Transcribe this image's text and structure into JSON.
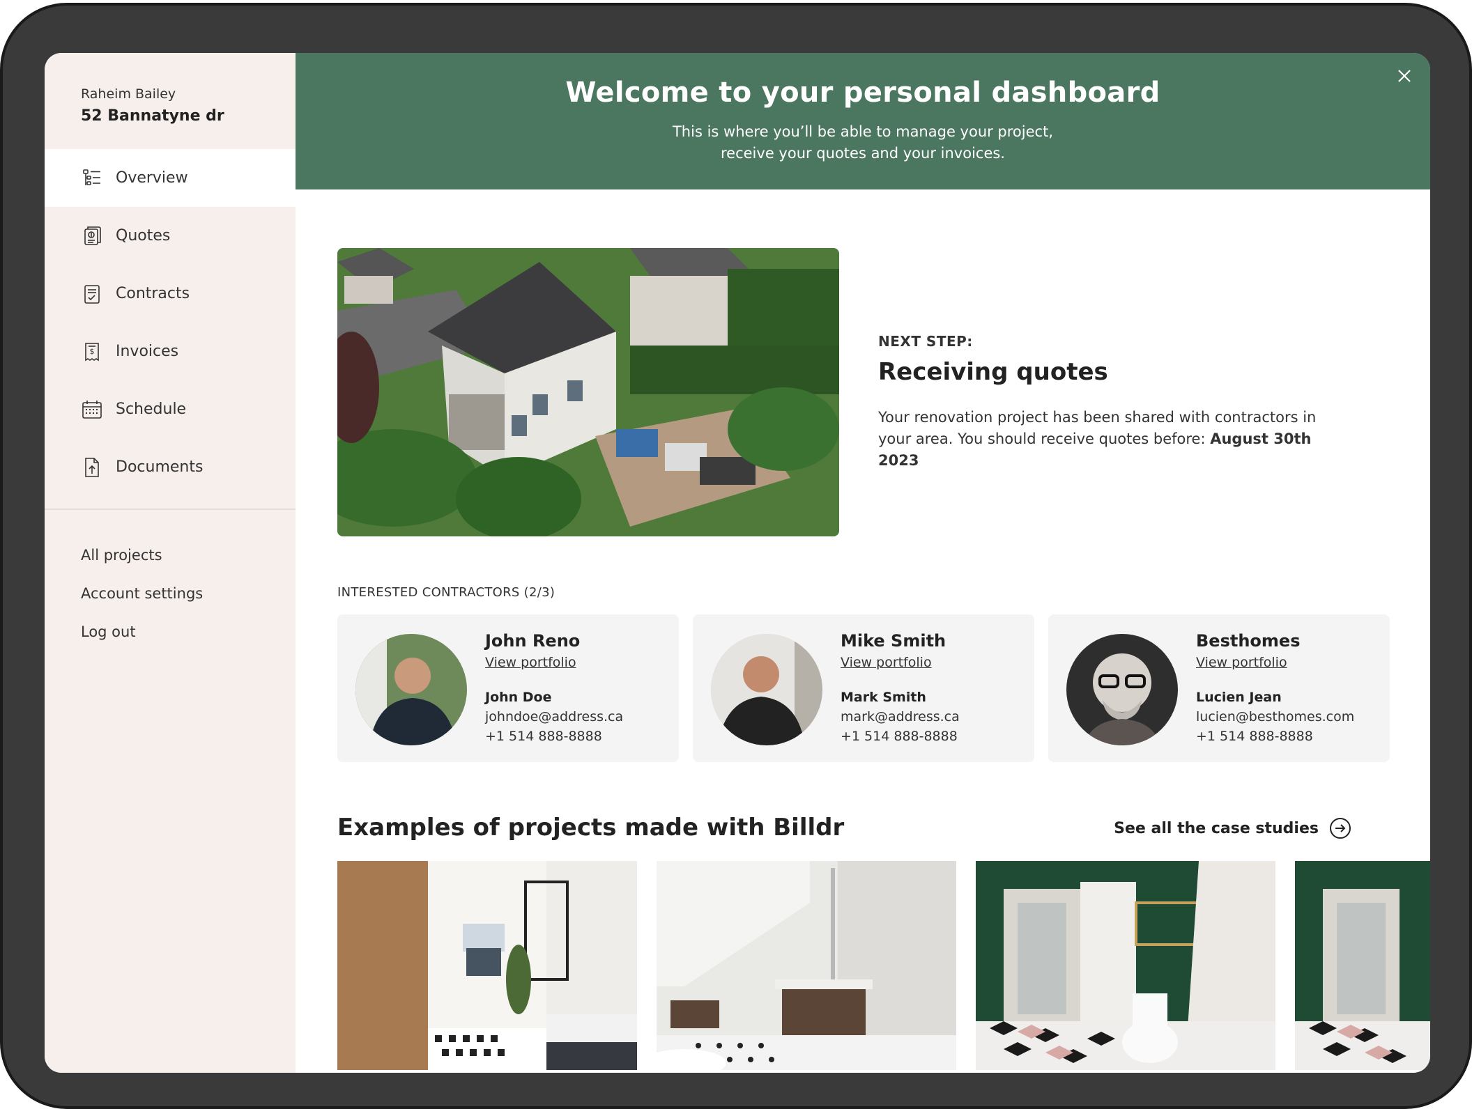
{
  "user": {
    "name": "Raheim Bailey",
    "address": "52 Bannatyne dr"
  },
  "sidebar": {
    "items": [
      {
        "label": "Overview",
        "icon": "overview-icon",
        "active": true
      },
      {
        "label": "Quotes",
        "icon": "quotes-icon"
      },
      {
        "label": "Contracts",
        "icon": "contracts-icon"
      },
      {
        "label": "Invoices",
        "icon": "invoices-icon"
      },
      {
        "label": "Schedule",
        "icon": "calendar-icon"
      },
      {
        "label": "Documents",
        "icon": "document-upload-icon"
      }
    ],
    "secondary": [
      {
        "label": "All projects"
      },
      {
        "label": "Account settings"
      },
      {
        "label": "Log out"
      }
    ]
  },
  "banner": {
    "title": "Welcome to your personal dashboard",
    "subtitle_line1": "This is where you’ll be able to manage your project,",
    "subtitle_line2": "receive your quotes and your invoices.",
    "close_icon": "close-icon"
  },
  "next_step": {
    "label": "NEXT STEP:",
    "title": "Receiving quotes",
    "description": "Your renovation project has been shared with contractors in your area. You should receive quotes before: ",
    "deadline": "August 30th 2023"
  },
  "contractors": {
    "label": "INTERESTED CONTRACTORS (2/3)",
    "items": [
      {
        "company": "John Reno",
        "link": "View portfolio",
        "contact": "John Doe",
        "email": "johndoe@address.ca",
        "phone": "+1 514 888-8888"
      },
      {
        "company": "Mike Smith",
        "link": "View portfolio",
        "contact": "Mark Smith",
        "email": "mark@address.ca",
        "phone": "+1 514 888-8888"
      },
      {
        "company": "Besthomes",
        "link": "View portfolio",
        "contact": "Lucien Jean",
        "email": "lucien@besthomes.com",
        "phone": "+1 514 888-8888"
      }
    ]
  },
  "examples": {
    "title": "Examples of projects made with Billdr",
    "see_all": "See all the case studies",
    "see_all_icon": "arrow-circle-right-icon"
  },
  "colors": {
    "banner_green": "#4b7660",
    "sidebar_bg": "#f7efec",
    "card_bg": "#f4f4f4"
  }
}
